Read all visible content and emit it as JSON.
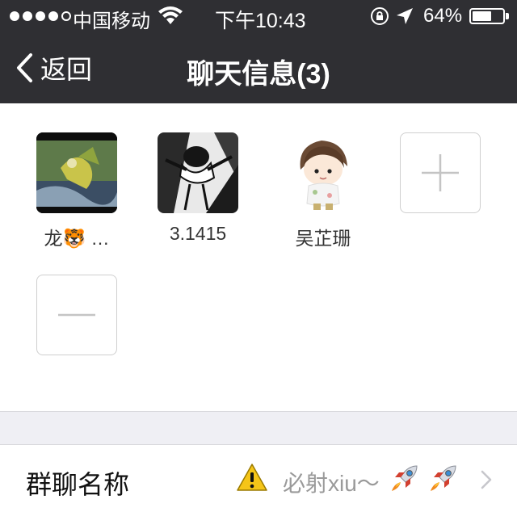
{
  "status_bar": {
    "carrier": "中国移动",
    "time": "下午10:43",
    "battery_percent": "64%",
    "battery_level": 0.64,
    "signal_bars_filled": 4,
    "signal_bars_total": 5
  },
  "nav": {
    "back_label": "返回",
    "title": "聊天信息(3)"
  },
  "members": [
    {
      "name": "龙🐯 …",
      "avatar": "photo-avatar-parrot"
    },
    {
      "name": "3.1415",
      "avatar": "photo-avatar-cartoon-bw"
    },
    {
      "name": "吴芷珊",
      "avatar": "sticker-avatar-boy"
    }
  ],
  "actions": {
    "add_icon": "plus-icon",
    "remove_icon": "minus-icon"
  },
  "group_name_row": {
    "label": "群聊名称",
    "value": "必射xiu～",
    "warning_icon": "warning-icon",
    "decoration_icon": "rocket-icon"
  },
  "colors": {
    "nav_background": "#2f2f33",
    "section_gap": "#efeff4",
    "value_text": "#9a9a9a"
  }
}
